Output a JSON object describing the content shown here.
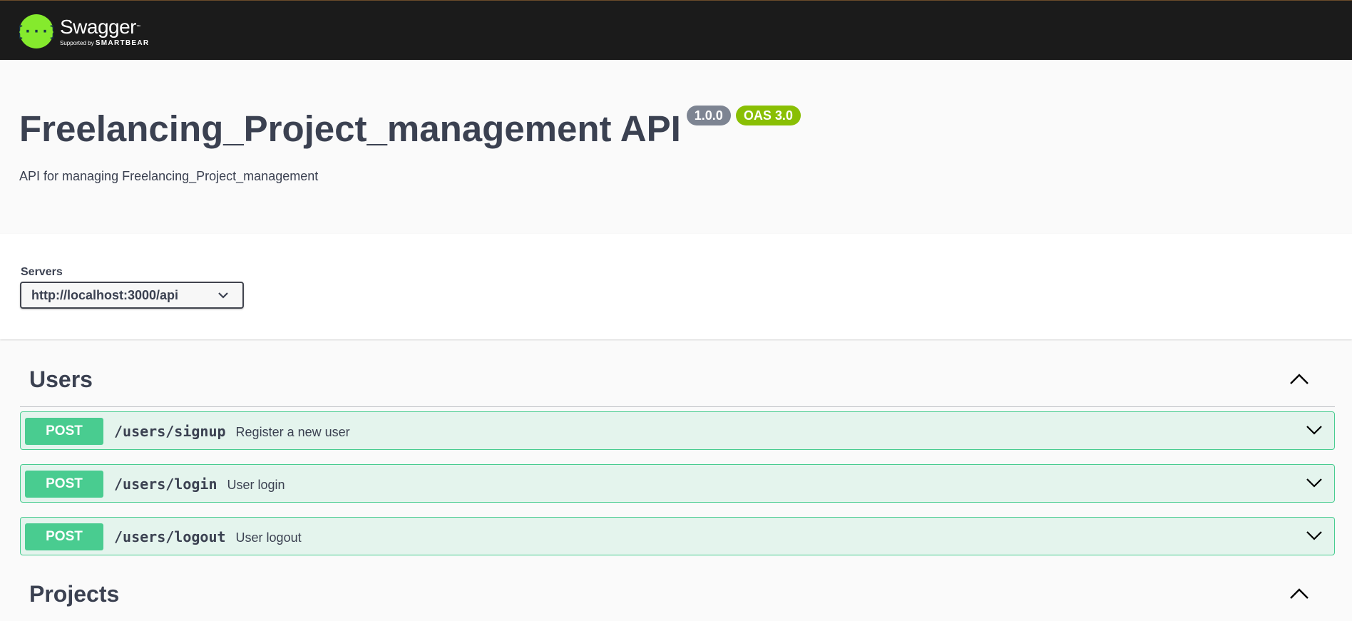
{
  "topbar": {
    "logo_name": "Swagger",
    "logo_tm": "™",
    "logo_supported_by": "Supported by",
    "logo_brand": "SMARTBEAR"
  },
  "info": {
    "title": "Freelancing_Project_management API",
    "version": "1.0.0",
    "oas_badge": "OAS 3.0",
    "description": "API for managing Freelancing_Project_management"
  },
  "servers": {
    "label": "Servers",
    "selected": "http://localhost:3000/api"
  },
  "tags": [
    {
      "name": "Users",
      "operations": [
        {
          "method": "POST",
          "path": "/users/signup",
          "summary": "Register a new user"
        },
        {
          "method": "POST",
          "path": "/users/login",
          "summary": "User login"
        },
        {
          "method": "POST",
          "path": "/users/logout",
          "summary": "User logout"
        }
      ]
    },
    {
      "name": "Projects",
      "operations": []
    }
  ],
  "colors": {
    "topbar_bg": "#1b1b1b",
    "logo_green": "#85ea2d",
    "post_green": "#49cc90",
    "version_badge": "#7d8492",
    "oas_badge": "#89bf04",
    "text": "#3b4151"
  },
  "icons": {
    "logo": "swagger-logo-icon",
    "server_dropdown": "chevron-down-icon",
    "tag_toggle": "chevron-up-icon",
    "op_toggle": "chevron-down-icon"
  }
}
